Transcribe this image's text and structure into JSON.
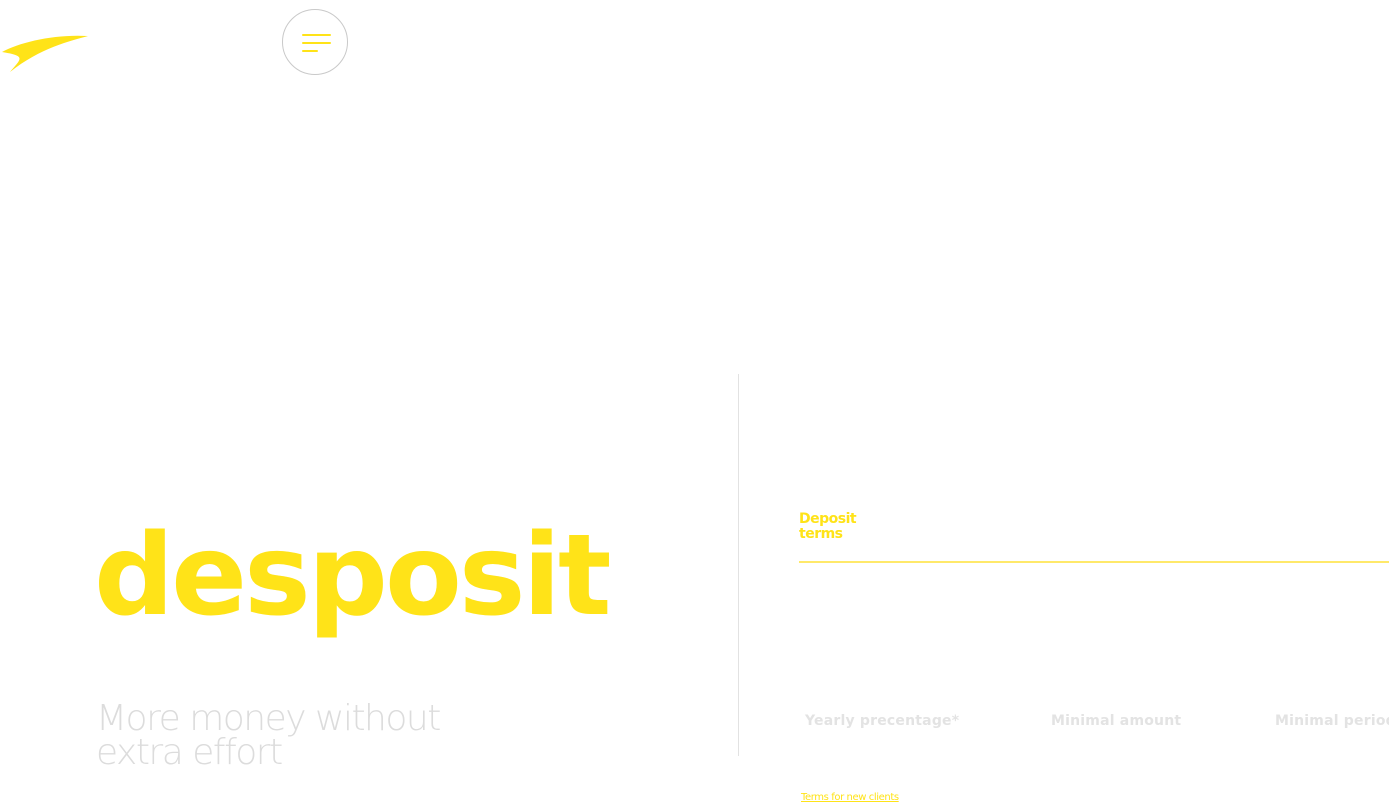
{
  "colors": {
    "accent": "#ffe318",
    "muted_text": "#dcdcdc",
    "column_text": "#e3e3e3",
    "divider": "#e2e2e2",
    "menu_border": "#c9c9c9"
  },
  "header": {
    "logo_icon": "swoosh-logo-icon",
    "menu_icon": "hamburger-menu-icon"
  },
  "hero": {
    "title": "desposit",
    "subtitle": "More money without extra effort"
  },
  "terms": {
    "heading": "Deposit terms",
    "columns": [
      {
        "label": "Yearly precentage*"
      },
      {
        "label": "Minimal amount"
      },
      {
        "label": "Minimal period"
      }
    ],
    "link_text": "Terms for new clients"
  }
}
